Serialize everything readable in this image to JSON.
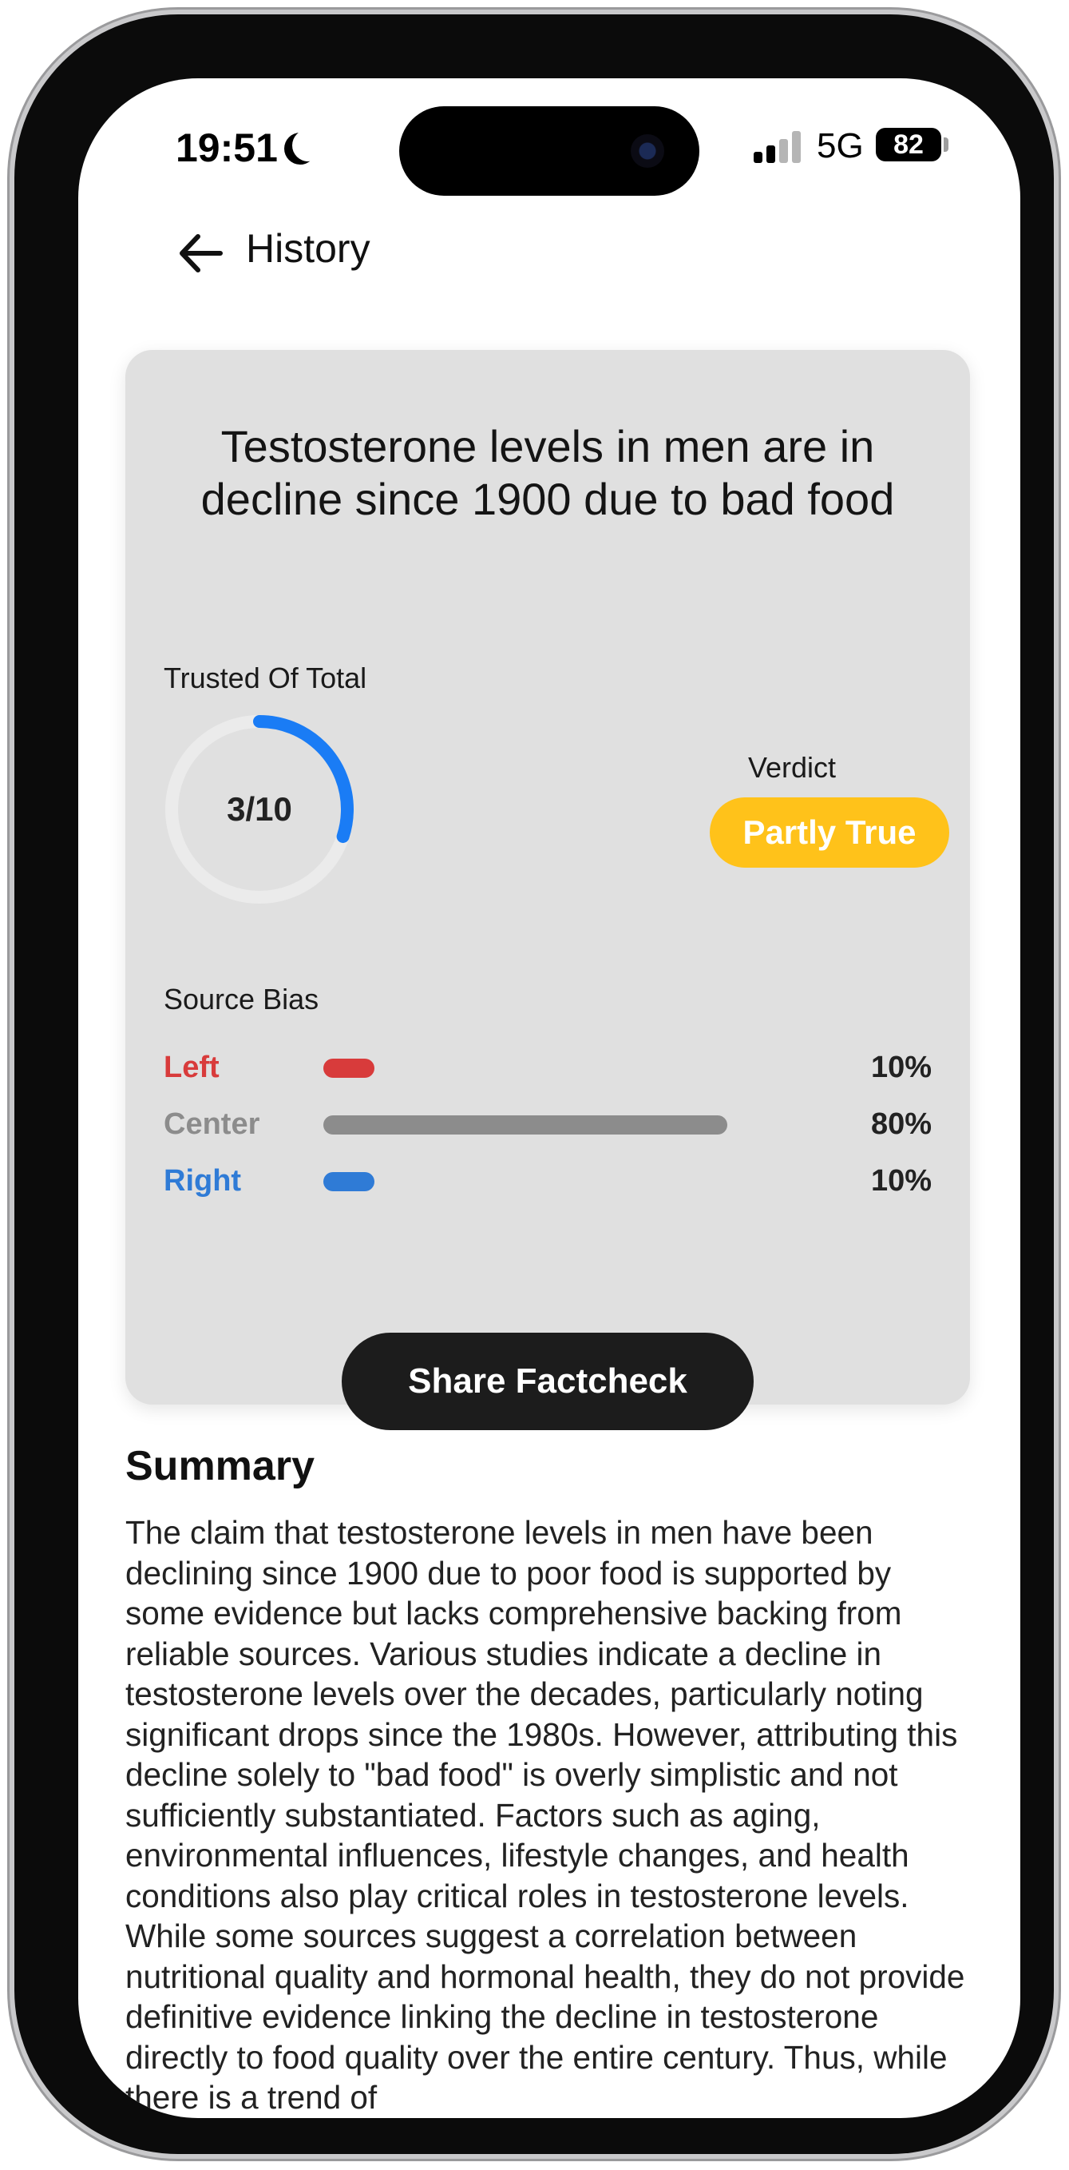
{
  "status_bar": {
    "time": "19:51",
    "network": "5G",
    "battery": "82",
    "moon_icon": "moon-icon",
    "signal_icon": "signal-bars-icon"
  },
  "header": {
    "back_icon": "arrow-left-icon",
    "back_label": "History"
  },
  "card": {
    "claim": "Testosterone levels in men are in decline since 1900 due to bad food",
    "trusted": {
      "label": "Trusted Of Total",
      "value_text": "3/10",
      "fraction": 0.3,
      "color": "#1a7cf5"
    },
    "verdict": {
      "label": "Verdict",
      "value": "Partly True",
      "color": "#ffc21a"
    },
    "source_bias": {
      "label": "Source Bias",
      "rows": [
        {
          "name": "Left",
          "percent_text": "10%",
          "value": 10,
          "color": "#d83b3b"
        },
        {
          "name": "Center",
          "percent_text": "80%",
          "value": 80,
          "color": "#8c8c8c"
        },
        {
          "name": "Right",
          "percent_text": "10%",
          "value": 10,
          "color": "#2f7bd6"
        }
      ]
    },
    "share_label": "Share Factcheck"
  },
  "summary": {
    "title": "Summary",
    "text": "The claim that testosterone levels in men have been declining since 1900 due to poor food is supported by some evidence but lacks comprehensive backing from reliable sources. Various studies indicate a decline in testosterone levels over the decades, particularly noting significant drops since the 1980s. However, attributing this decline solely to \"bad food\" is overly simplistic and not sufficiently substantiated. Factors such as aging, environmental influences, lifestyle changes, and health conditions also play critical roles in testosterone levels. While some sources suggest a correlation between nutritional quality and hormonal health, they do not provide definitive evidence linking the decline in testosterone directly to food quality over the entire century. Thus, while there is a trend of"
  }
}
